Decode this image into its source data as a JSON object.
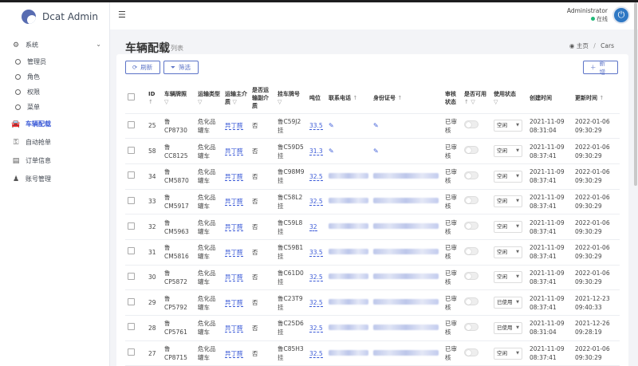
{
  "app": {
    "name": "Dcat Admin"
  },
  "user": {
    "name": "Administrator",
    "status": "在线"
  },
  "sidebar": {
    "items": [
      {
        "label": "系统",
        "icon": "gear-icon",
        "type": "top"
      },
      {
        "label": "管理员",
        "type": "sub"
      },
      {
        "label": "角色",
        "type": "sub"
      },
      {
        "label": "权限",
        "type": "sub"
      },
      {
        "label": "菜单",
        "type": "sub"
      },
      {
        "label": "车辆配载",
        "icon": "car-icon",
        "type": "top",
        "active": true
      },
      {
        "label": "自动抢单",
        "icon": "robot-icon",
        "type": "top"
      },
      {
        "label": "订单信息",
        "icon": "id-card-icon",
        "type": "top"
      },
      {
        "label": "账号管理",
        "icon": "user-lock-icon",
        "type": "top"
      }
    ]
  },
  "page": {
    "title": "车辆配载",
    "subtitle": "列表"
  },
  "breadcrumb": {
    "home": "主页",
    "current": "Cars"
  },
  "toolbar": {
    "refresh": "刷新",
    "filter": "筛选",
    "add": "新增"
  },
  "table": {
    "headers": {
      "id": "ID",
      "plate": "车辆牌照",
      "transport": "运输类型",
      "medium": "运输主介质",
      "has_medium": "是否运输副介质",
      "trailer": "挂车牌号",
      "tonnage": "吨位",
      "phone": "联系电话",
      "idcard": "身份证号",
      "audit": "审核状态",
      "available": "是否可用",
      "usage": "使用状态",
      "created": "创建时间",
      "updated": "更新时间"
    },
    "rows": [
      {
        "id": "25",
        "plate1": "鲁",
        "plate2": "CP8730",
        "transport1": "危化品",
        "transport2": "罐车",
        "medium": "异丁醛",
        "has_medium": "否",
        "trailer1": "鲁C59J2",
        "trailer2": "挂",
        "tonnage": "33.5",
        "phone": "",
        "idcard": "",
        "audit1": "已审",
        "audit2": "核",
        "usage": "空闲",
        "created1": "2021-11-09",
        "created2": "08:31:04",
        "updated1": "2022-01-06",
        "updated2": "09:30:29"
      },
      {
        "id": "58",
        "plate1": "鲁",
        "plate2": "CC8125",
        "transport1": "危化品",
        "transport2": "罐车",
        "medium": "异丁醛",
        "has_medium": "否",
        "trailer1": "鲁C59D5",
        "trailer2": "挂",
        "tonnage": "31.3",
        "phone": "",
        "idcard": "",
        "audit1": "已审",
        "audit2": "核",
        "usage": "空闲",
        "created1": "2021-11-09",
        "created2": "08:37:41",
        "updated1": "2022-01-06",
        "updated2": "09:30:29"
      },
      {
        "id": "34",
        "plate1": "鲁",
        "plate2": "CM5870",
        "transport1": "危化品",
        "transport2": "罐车",
        "medium": "异丁醛",
        "has_medium": "否",
        "trailer1": "鲁C98M9",
        "trailer2": "挂",
        "tonnage": "32.5",
        "phone": "",
        "idcard": "",
        "audit1": "已审",
        "audit2": "核",
        "usage": "空闲",
        "created1": "2021-11-09",
        "created2": "08:37:41",
        "updated1": "2022-01-06",
        "updated2": "09:30:29"
      },
      {
        "id": "33",
        "plate1": "鲁",
        "plate2": "CM5917",
        "transport1": "危化品",
        "transport2": "罐车",
        "medium": "异丁醛",
        "has_medium": "否",
        "trailer1": "鲁C58L2",
        "trailer2": "挂",
        "tonnage": "32.5",
        "phone": "",
        "idcard": "",
        "audit1": "已审",
        "audit2": "核",
        "usage": "空闲",
        "created1": "2021-11-09",
        "created2": "08:37:41",
        "updated1": "2022-01-06",
        "updated2": "09:30:29"
      },
      {
        "id": "32",
        "plate1": "鲁",
        "plate2": "CM5963",
        "transport1": "危化品",
        "transport2": "罐车",
        "medium": "异丁醛",
        "has_medium": "否",
        "trailer1": "鲁C59L8",
        "trailer2": "挂",
        "tonnage": "32",
        "phone": "",
        "idcard": "",
        "audit1": "已审",
        "audit2": "核",
        "usage": "空闲",
        "created1": "2021-11-09",
        "created2": "08:37:41",
        "updated1": "2022-01-06",
        "updated2": "09:30:29"
      },
      {
        "id": "31",
        "plate1": "鲁",
        "plate2": "CM5816",
        "transport1": "危化品",
        "transport2": "罐车",
        "medium": "异丁醛",
        "has_medium": "否",
        "trailer1": "鲁C59B1",
        "trailer2": "挂",
        "tonnage": "33.5",
        "phone": "",
        "idcard": "",
        "audit1": "已审",
        "audit2": "核",
        "usage": "空闲",
        "created1": "2021-11-09",
        "created2": "08:37:41",
        "updated1": "2022-01-06",
        "updated2": "09:30:29"
      },
      {
        "id": "30",
        "plate1": "鲁",
        "plate2": "CP5872",
        "transport1": "危化品",
        "transport2": "罐车",
        "medium": "异丁醛",
        "has_medium": "否",
        "trailer1": "鲁C61D0",
        "trailer2": "挂",
        "tonnage": "32.5",
        "phone": "",
        "idcard": "",
        "audit1": "已审",
        "audit2": "核",
        "usage": "空闲",
        "created1": "2021-11-09",
        "created2": "08:37:41",
        "updated1": "2022-01-06",
        "updated2": "09:30:29"
      },
      {
        "id": "29",
        "plate1": "鲁",
        "plate2": "CP5792",
        "transport1": "危化品",
        "transport2": "罐车",
        "medium": "异丁醛",
        "has_medium": "否",
        "trailer1": "鲁C23T9",
        "trailer2": "挂",
        "tonnage": "32.5",
        "phone": "",
        "idcard": "",
        "audit1": "已审",
        "audit2": "核",
        "usage": "已使用",
        "created1": "2021-11-09",
        "created2": "08:37:41",
        "updated1": "2021-12-23",
        "updated2": "09:40:33"
      },
      {
        "id": "28",
        "plate1": "鲁",
        "plate2": "CP5761",
        "transport1": "危化品",
        "transport2": "罐车",
        "medium": "异丁醛",
        "has_medium": "否",
        "trailer1": "鲁C25D6",
        "trailer2": "挂",
        "tonnage": "32.5",
        "phone": "",
        "idcard": "",
        "audit1": "已审",
        "audit2": "核",
        "usage": "已使用",
        "created1": "2021-11-09",
        "created2": "08:31:04",
        "updated1": "2021-12-26",
        "updated2": "09:28:19"
      },
      {
        "id": "27",
        "plate1": "鲁",
        "plate2": "CP8715",
        "transport1": "危化品",
        "transport2": "罐车",
        "medium": "异丁醛",
        "has_medium": "否",
        "trailer1": "鲁C85H3",
        "trailer2": "挂",
        "tonnage": "32.5",
        "phone": "",
        "idcard": "",
        "audit1": "已审",
        "audit2": "核",
        "usage": "空闲",
        "created1": "2021-11-09",
        "created2": "08:37:41",
        "updated1": "2022-01-06",
        "updated2": "09:30:29"
      }
    ]
  },
  "colors": {
    "accent": "#3c5bd7",
    "online": "#21b978"
  }
}
